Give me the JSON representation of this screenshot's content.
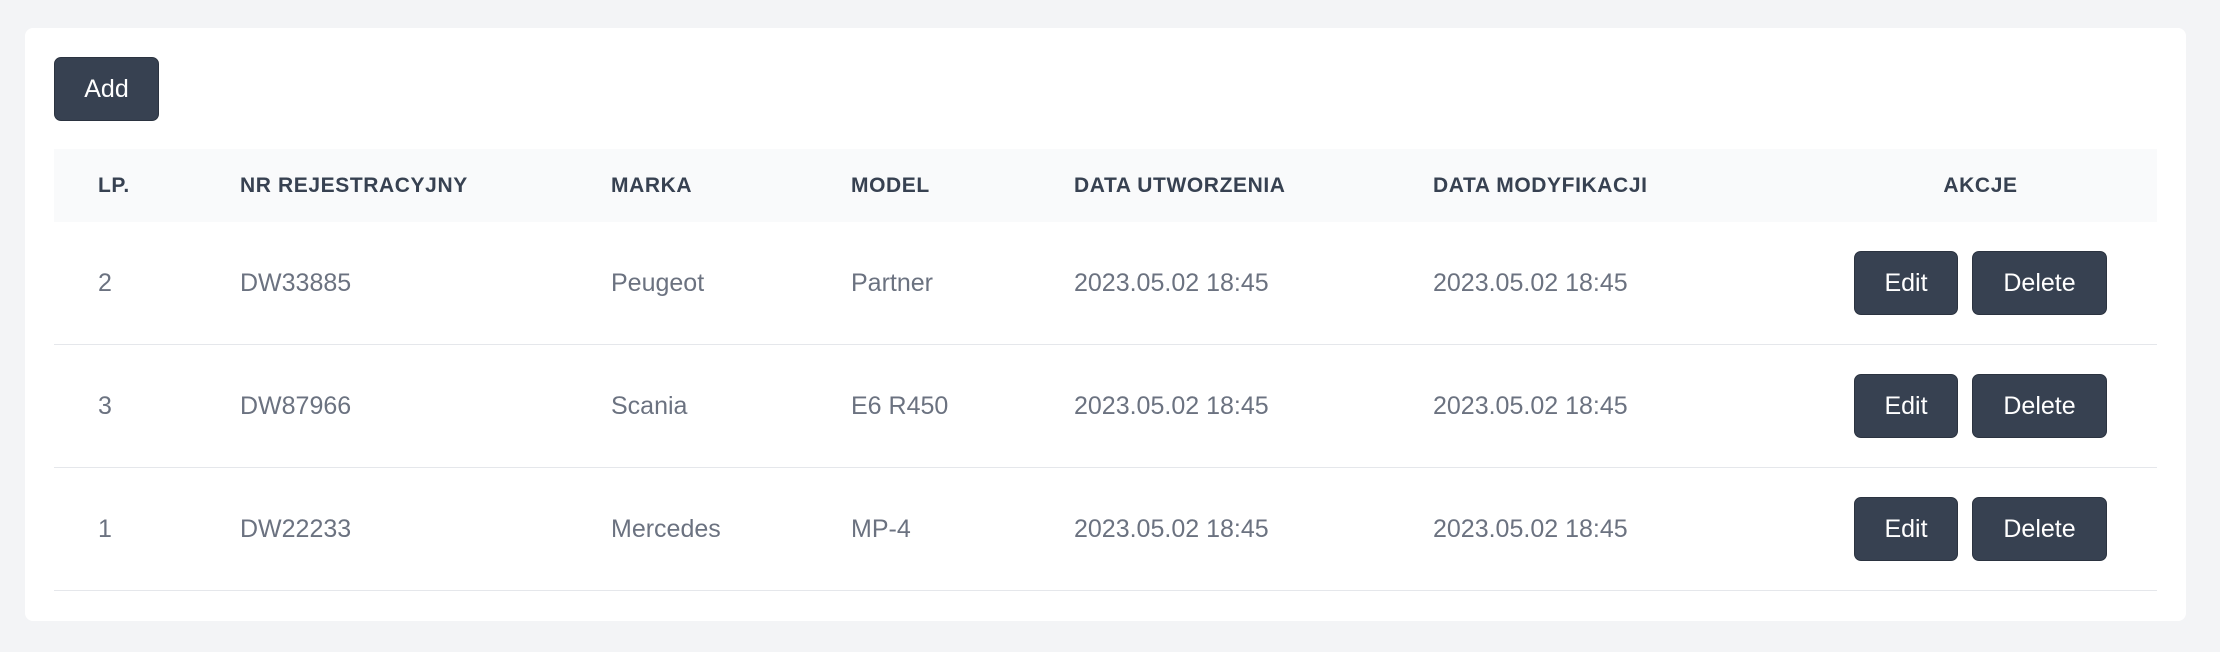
{
  "toolbar": {
    "add_label": "Add"
  },
  "table": {
    "headers": {
      "lp": "LP.",
      "nr": "NR REJESTRACYJNY",
      "marka": "MARKA",
      "model": "MODEL",
      "created": "DATA UTWORZENIA",
      "modified": "DATA MODYFIKACJI",
      "actions": "AKCJE"
    },
    "rows": [
      {
        "lp": "2",
        "nr": "DW33885",
        "marka": "Peugeot",
        "model": "Partner",
        "created": "2023.05.02 18:45",
        "modified": "2023.05.02 18:45",
        "edit_label": "Edit",
        "delete_label": "Delete"
      },
      {
        "lp": "3",
        "nr": "DW87966",
        "marka": "Scania",
        "model": "E6 R450",
        "created": "2023.05.02 18:45",
        "modified": "2023.05.02 18:45",
        "edit_label": "Edit",
        "delete_label": "Delete"
      },
      {
        "lp": "1",
        "nr": "DW22233",
        "marka": "Mercedes",
        "model": "MP-4",
        "created": "2023.05.02 18:45",
        "modified": "2023.05.02 18:45",
        "edit_label": "Edit",
        "delete_label": "Delete"
      }
    ]
  }
}
